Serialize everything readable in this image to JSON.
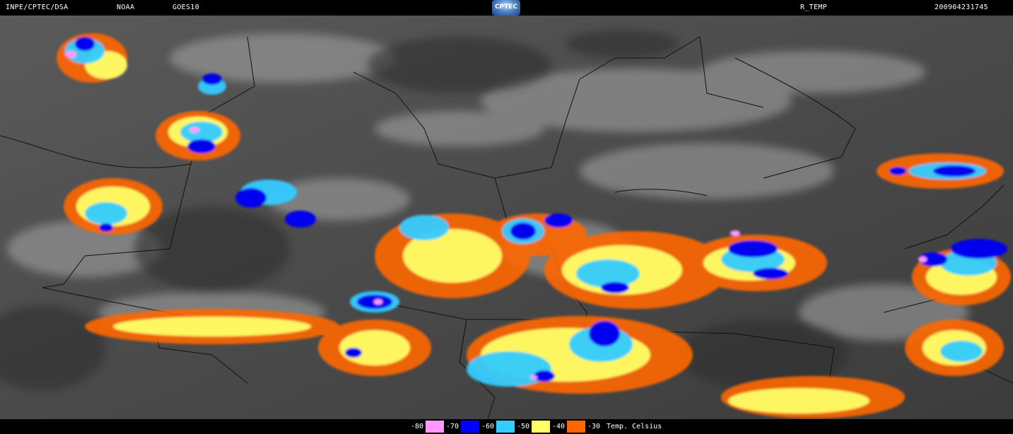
{
  "header": {
    "agency": "INPE/CPTEC/DSA",
    "provider": "NOAA",
    "satellite": "GOES10",
    "logo_text": "CPTEC",
    "product": "R_TEMP",
    "timestamp": "200904231745"
  },
  "legend": {
    "title": "Temp. Celsius",
    "levels": [
      {
        "label": "-80",
        "color": "#ff99ff"
      },
      {
        "label": "-70",
        "color": "#0000ff"
      },
      {
        "label": "-60",
        "color": "#00ccff"
      },
      {
        "label": "-50",
        "color": "#ffff66"
      },
      {
        "label": "-40",
        "color": "#ff6600"
      },
      {
        "label": "-30",
        "color": "#000000"
      }
    ]
  },
  "colors": {
    "background_clear": "#3a3a3a",
    "cloud_gray": "#9a9a9a",
    "border_line": "#000000"
  }
}
